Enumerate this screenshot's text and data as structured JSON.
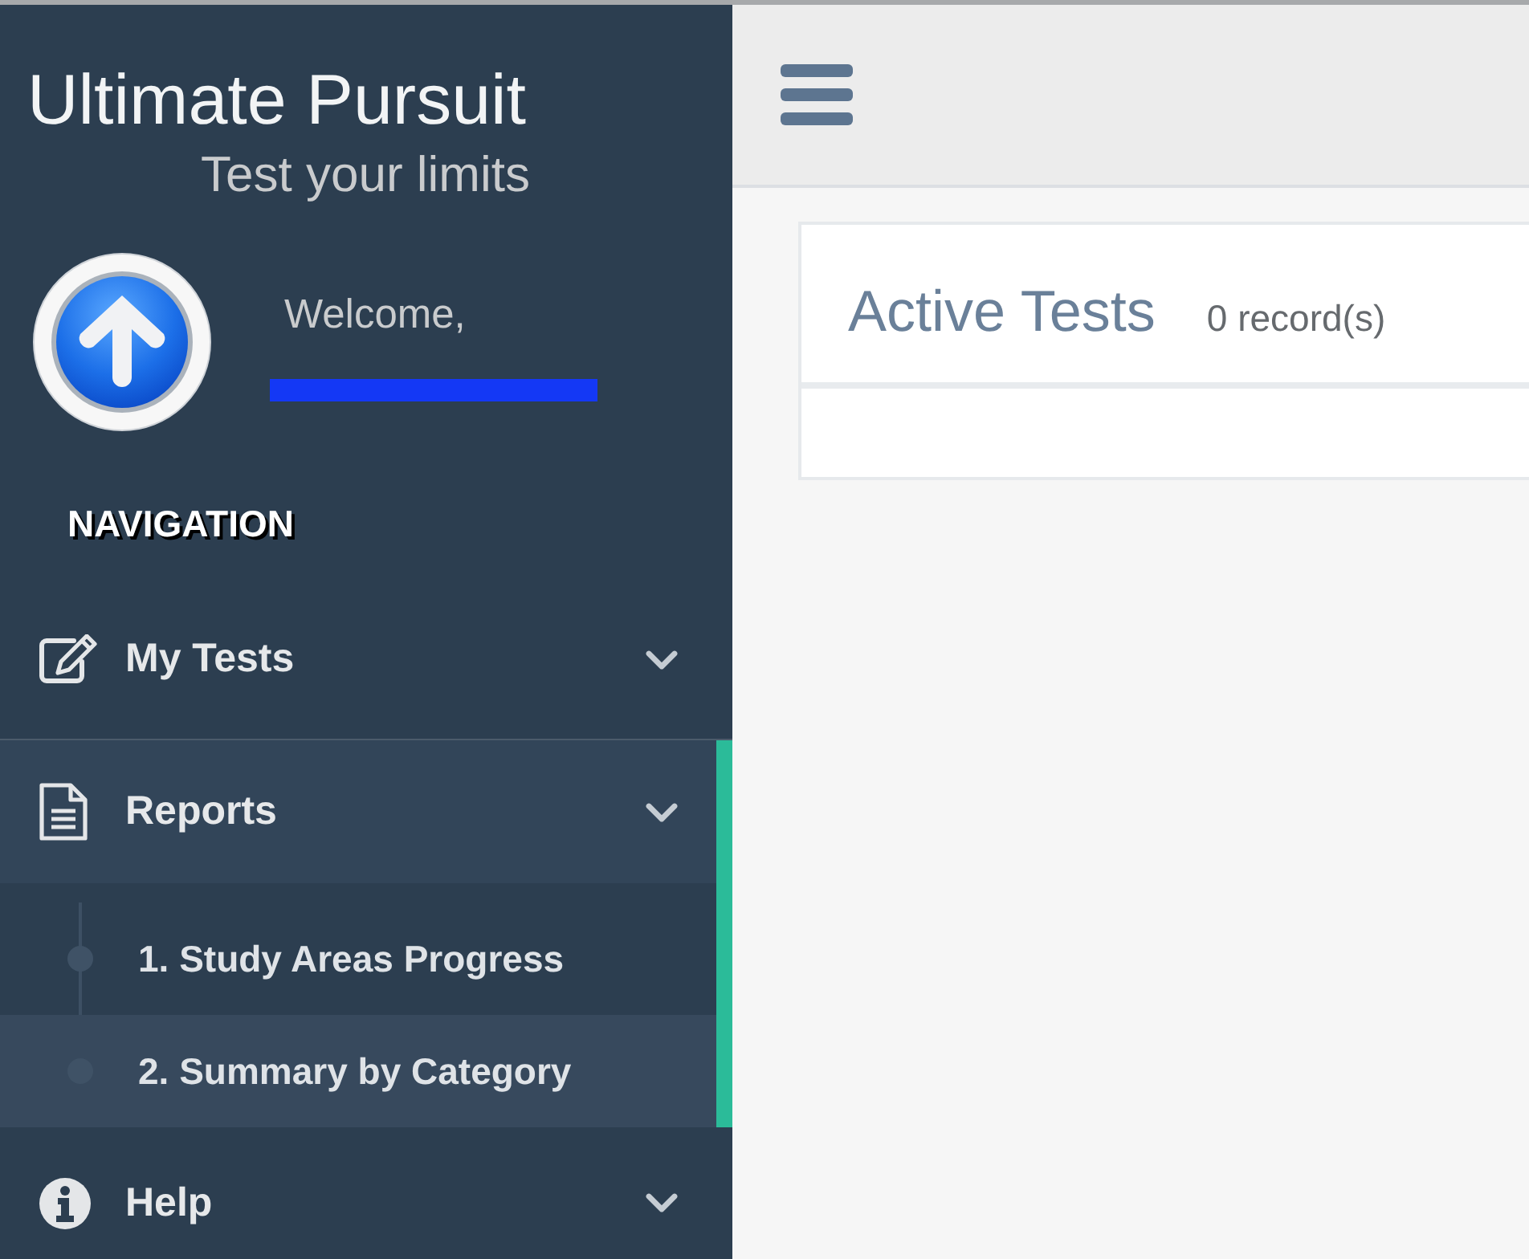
{
  "brand": {
    "title": "Ultimate Pursuit",
    "tagline": "Test your limits"
  },
  "user": {
    "greeting": "Welcome,",
    "name_redacted": true
  },
  "navigation": {
    "heading": "NAVIGATION",
    "items": [
      {
        "label": "My Tests",
        "expanded": false
      },
      {
        "label": "Reports",
        "expanded": true,
        "children": [
          {
            "label": "1. Study Areas Progress",
            "selected": false
          },
          {
            "label": "2. Summary by Category",
            "selected": true
          }
        ]
      },
      {
        "label": "Help",
        "expanded": false
      }
    ]
  },
  "panel": {
    "title": "Active Tests",
    "count": "0 record(s)"
  }
}
